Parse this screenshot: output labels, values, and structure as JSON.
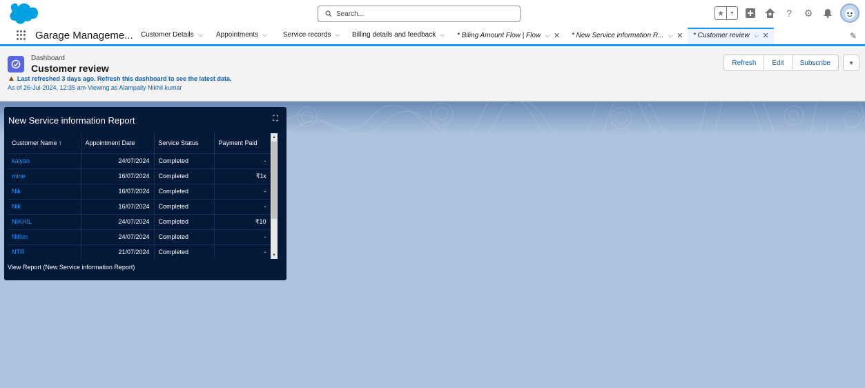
{
  "search": {
    "placeholder": "Search..."
  },
  "nav": {
    "app_name": "Garage Manageme...",
    "items": [
      {
        "label": "Customer Details"
      },
      {
        "label": "Appointments"
      },
      {
        "label": "Service records"
      },
      {
        "label": "Billing details and feedback"
      }
    ],
    "workspace_tabs": [
      {
        "label": "* Biling Amount Flow | Flow"
      },
      {
        "label": "* New Service information R..."
      },
      {
        "label": "* Customer review"
      }
    ]
  },
  "dashboard": {
    "type_label": "Dashboard",
    "title": "Customer review",
    "warning": "Last refreshed 3 days ago. Refresh this dashboard to see the latest data.",
    "as_of": "As of 26-Jul-2024, 12:35 am·Viewing as Alampally Nikhil kumar",
    "buttons": {
      "refresh": "Refresh",
      "edit": "Edit",
      "subscribe": "Subscribe"
    }
  },
  "widget": {
    "title": "New Service information Report",
    "columns": [
      "Customer Name ↑",
      "Appointment Date",
      "Service Status",
      "Payment Paid"
    ],
    "rows": [
      {
        "name": "kalyan",
        "date": "24/07/2024",
        "status": "Completed",
        "paid": "-"
      },
      {
        "name": "mine",
        "date": "16/07/2024",
        "status": "Completed",
        "paid": "₹1к"
      },
      {
        "name": "Nik",
        "date": "16/07/2024",
        "status": "Completed",
        "paid": "-"
      },
      {
        "name": "Nik",
        "date": "16/07/2024",
        "status": "Completed",
        "paid": "-"
      },
      {
        "name": "NIKHIL",
        "date": "24/07/2024",
        "status": "Completed",
        "paid": "₹10"
      },
      {
        "name": "Nithin",
        "date": "24/07/2024",
        "status": "Completed",
        "paid": "-"
      },
      {
        "name": "NTR",
        "date": "21/07/2024",
        "status": "Completed",
        "paid": "-"
      }
    ],
    "view_report": "View Report (New Service information Report)"
  },
  "colors": {
    "brand": "#1b96ff",
    "widget_bg": "#031938",
    "canvas_bg": "#aec3dd",
    "link": "#0b5cab",
    "dashboard_icon": "#5867e8"
  },
  "icons": [
    "salesforce-cloud-icon",
    "search-icon",
    "favorites-star-icon",
    "add-icon",
    "trailhead-icon",
    "help-icon",
    "setup-gear-icon",
    "notification-bell-icon",
    "waffle-icon",
    "chevron-down-icon",
    "close-icon",
    "edit-pencil-icon",
    "dashboard-icon",
    "warning-icon",
    "expand-icon"
  ]
}
